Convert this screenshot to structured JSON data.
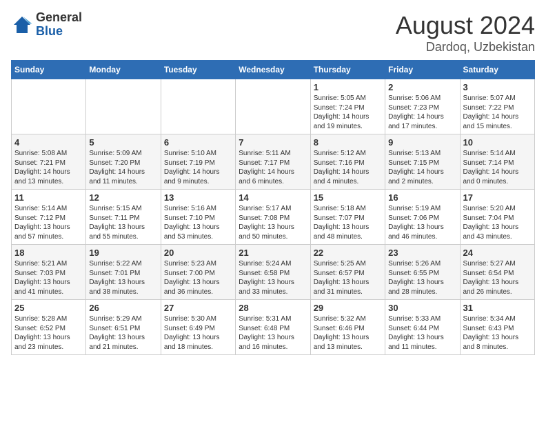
{
  "header": {
    "logo_general": "General",
    "logo_blue": "Blue",
    "month": "August 2024",
    "location": "Dardoq, Uzbekistan"
  },
  "weekdays": [
    "Sunday",
    "Monday",
    "Tuesday",
    "Wednesday",
    "Thursday",
    "Friday",
    "Saturday"
  ],
  "weeks": [
    [
      {
        "day": "",
        "info": ""
      },
      {
        "day": "",
        "info": ""
      },
      {
        "day": "",
        "info": ""
      },
      {
        "day": "",
        "info": ""
      },
      {
        "day": "1",
        "info": "Sunrise: 5:05 AM\nSunset: 7:24 PM\nDaylight: 14 hours\nand 19 minutes."
      },
      {
        "day": "2",
        "info": "Sunrise: 5:06 AM\nSunset: 7:23 PM\nDaylight: 14 hours\nand 17 minutes."
      },
      {
        "day": "3",
        "info": "Sunrise: 5:07 AM\nSunset: 7:22 PM\nDaylight: 14 hours\nand 15 minutes."
      }
    ],
    [
      {
        "day": "4",
        "info": "Sunrise: 5:08 AM\nSunset: 7:21 PM\nDaylight: 14 hours\nand 13 minutes."
      },
      {
        "day": "5",
        "info": "Sunrise: 5:09 AM\nSunset: 7:20 PM\nDaylight: 14 hours\nand 11 minutes."
      },
      {
        "day": "6",
        "info": "Sunrise: 5:10 AM\nSunset: 7:19 PM\nDaylight: 14 hours\nand 9 minutes."
      },
      {
        "day": "7",
        "info": "Sunrise: 5:11 AM\nSunset: 7:17 PM\nDaylight: 14 hours\nand 6 minutes."
      },
      {
        "day": "8",
        "info": "Sunrise: 5:12 AM\nSunset: 7:16 PM\nDaylight: 14 hours\nand 4 minutes."
      },
      {
        "day": "9",
        "info": "Sunrise: 5:13 AM\nSunset: 7:15 PM\nDaylight: 14 hours\nand 2 minutes."
      },
      {
        "day": "10",
        "info": "Sunrise: 5:14 AM\nSunset: 7:14 PM\nDaylight: 14 hours\nand 0 minutes."
      }
    ],
    [
      {
        "day": "11",
        "info": "Sunrise: 5:14 AM\nSunset: 7:12 PM\nDaylight: 13 hours\nand 57 minutes."
      },
      {
        "day": "12",
        "info": "Sunrise: 5:15 AM\nSunset: 7:11 PM\nDaylight: 13 hours\nand 55 minutes."
      },
      {
        "day": "13",
        "info": "Sunrise: 5:16 AM\nSunset: 7:10 PM\nDaylight: 13 hours\nand 53 minutes."
      },
      {
        "day": "14",
        "info": "Sunrise: 5:17 AM\nSunset: 7:08 PM\nDaylight: 13 hours\nand 50 minutes."
      },
      {
        "day": "15",
        "info": "Sunrise: 5:18 AM\nSunset: 7:07 PM\nDaylight: 13 hours\nand 48 minutes."
      },
      {
        "day": "16",
        "info": "Sunrise: 5:19 AM\nSunset: 7:06 PM\nDaylight: 13 hours\nand 46 minutes."
      },
      {
        "day": "17",
        "info": "Sunrise: 5:20 AM\nSunset: 7:04 PM\nDaylight: 13 hours\nand 43 minutes."
      }
    ],
    [
      {
        "day": "18",
        "info": "Sunrise: 5:21 AM\nSunset: 7:03 PM\nDaylight: 13 hours\nand 41 minutes."
      },
      {
        "day": "19",
        "info": "Sunrise: 5:22 AM\nSunset: 7:01 PM\nDaylight: 13 hours\nand 38 minutes."
      },
      {
        "day": "20",
        "info": "Sunrise: 5:23 AM\nSunset: 7:00 PM\nDaylight: 13 hours\nand 36 minutes."
      },
      {
        "day": "21",
        "info": "Sunrise: 5:24 AM\nSunset: 6:58 PM\nDaylight: 13 hours\nand 33 minutes."
      },
      {
        "day": "22",
        "info": "Sunrise: 5:25 AM\nSunset: 6:57 PM\nDaylight: 13 hours\nand 31 minutes."
      },
      {
        "day": "23",
        "info": "Sunrise: 5:26 AM\nSunset: 6:55 PM\nDaylight: 13 hours\nand 28 minutes."
      },
      {
        "day": "24",
        "info": "Sunrise: 5:27 AM\nSunset: 6:54 PM\nDaylight: 13 hours\nand 26 minutes."
      }
    ],
    [
      {
        "day": "25",
        "info": "Sunrise: 5:28 AM\nSunset: 6:52 PM\nDaylight: 13 hours\nand 23 minutes."
      },
      {
        "day": "26",
        "info": "Sunrise: 5:29 AM\nSunset: 6:51 PM\nDaylight: 13 hours\nand 21 minutes."
      },
      {
        "day": "27",
        "info": "Sunrise: 5:30 AM\nSunset: 6:49 PM\nDaylight: 13 hours\nand 18 minutes."
      },
      {
        "day": "28",
        "info": "Sunrise: 5:31 AM\nSunset: 6:48 PM\nDaylight: 13 hours\nand 16 minutes."
      },
      {
        "day": "29",
        "info": "Sunrise: 5:32 AM\nSunset: 6:46 PM\nDaylight: 13 hours\nand 13 minutes."
      },
      {
        "day": "30",
        "info": "Sunrise: 5:33 AM\nSunset: 6:44 PM\nDaylight: 13 hours\nand 11 minutes."
      },
      {
        "day": "31",
        "info": "Sunrise: 5:34 AM\nSunset: 6:43 PM\nDaylight: 13 hours\nand 8 minutes."
      }
    ]
  ]
}
